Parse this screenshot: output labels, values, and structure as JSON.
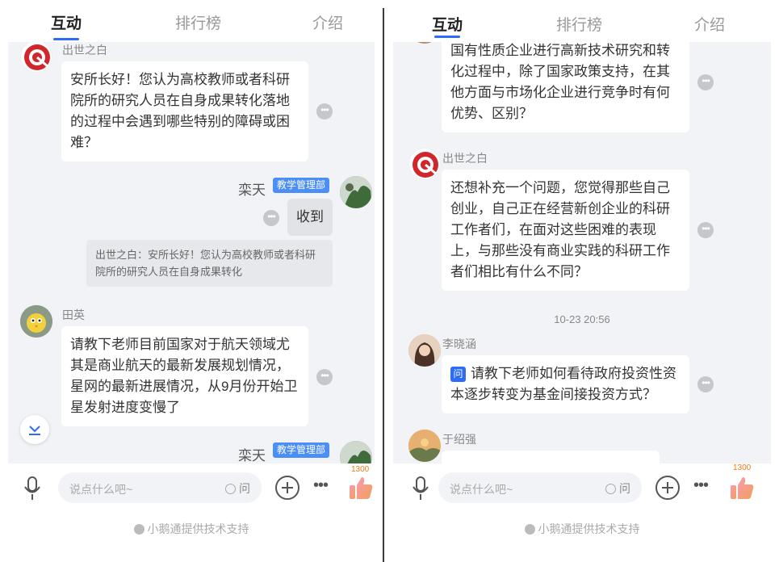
{
  "tabs": [
    "互动",
    "排行榜",
    "介绍"
  ],
  "left": {
    "msg1": {
      "name": "出世之白",
      "text": "安所长好！您认为高校教师或者科研院所的研究人员在自身成果转化落地的过程中会遇到哪些特别的障碍或困难？"
    },
    "msg2": {
      "name": "栾天",
      "badge": "教学管理部",
      "text": "收到",
      "quote": "出世之白：安所长好！您认为高校教师或者科研院所的研究人员在自身成果转化"
    },
    "msg3": {
      "name": "田英",
      "text": "请教下老师目前国家对于航天领域尤其是商业航天的最新发展规划情况，星网的最新进展情况，从9月份开始卫星发射进度变慢了"
    },
    "msg4": {
      "name": "栾天",
      "badge": "教学管理部"
    }
  },
  "right": {
    "msg1": {
      "text": "国有性质企业进行高新技术研究和转化过程中，除了国家政策支持，在其他方面与市场化企业进行竞争时有何优势、区别？"
    },
    "msg2": {
      "name": "出世之白",
      "text": "还想补充一个问题，您觉得那些自己创业，自己正在经营新创企业的科研工作者们，在面对这些困难的表现上，与那些没有商业实践的科研工作者们相比有什么不同？"
    },
    "timestamp": "10-23 20:56",
    "msg3": {
      "name": "李晓涵",
      "tag": "问",
      "text": "请教下老师如何看待政府投资性资本逐步转变为基金间接投资方式？"
    },
    "msg4": {
      "name": "于绍强"
    }
  },
  "input": {
    "placeholder": "说点什么吧~",
    "ask_label": "问"
  },
  "like_count": "1300",
  "footer": "小鹅通提供技术支持",
  "colors": {
    "accent": "#2d6cf6",
    "badge": "#4b8ef5",
    "like": "#f07a17"
  }
}
